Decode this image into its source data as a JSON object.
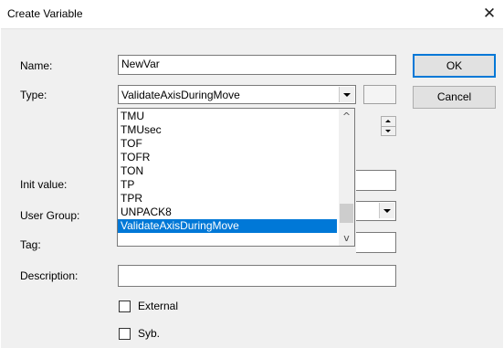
{
  "window": {
    "title": "Create Variable",
    "close_glyph": "✕"
  },
  "form": {
    "name_label": "Name:",
    "name_value": "NewVar",
    "type_label": "Type:",
    "type_value": "ValidateAxisDuringMove",
    "init_label": "Init value:",
    "group_label": "User Group:",
    "tag_label": "Tag:",
    "desc_label": "Description:",
    "external_label": "External",
    "syb_label": "Syb."
  },
  "buttons": {
    "ok": "OK",
    "cancel": "Cancel"
  },
  "type_dropdown": {
    "items": [
      "TMU",
      "TMUsec",
      "TOF",
      "TOFR",
      "TON",
      "TP",
      "TPR",
      "UNPACK8",
      "ValidateAxisDuringMove"
    ],
    "selected": "ValidateAxisDuringMove",
    "scroll_up_glyph": "^",
    "scroll_down_glyph": "v"
  },
  "colors": {
    "selection": "#0078d7",
    "default_button_border": "#0078d7"
  }
}
